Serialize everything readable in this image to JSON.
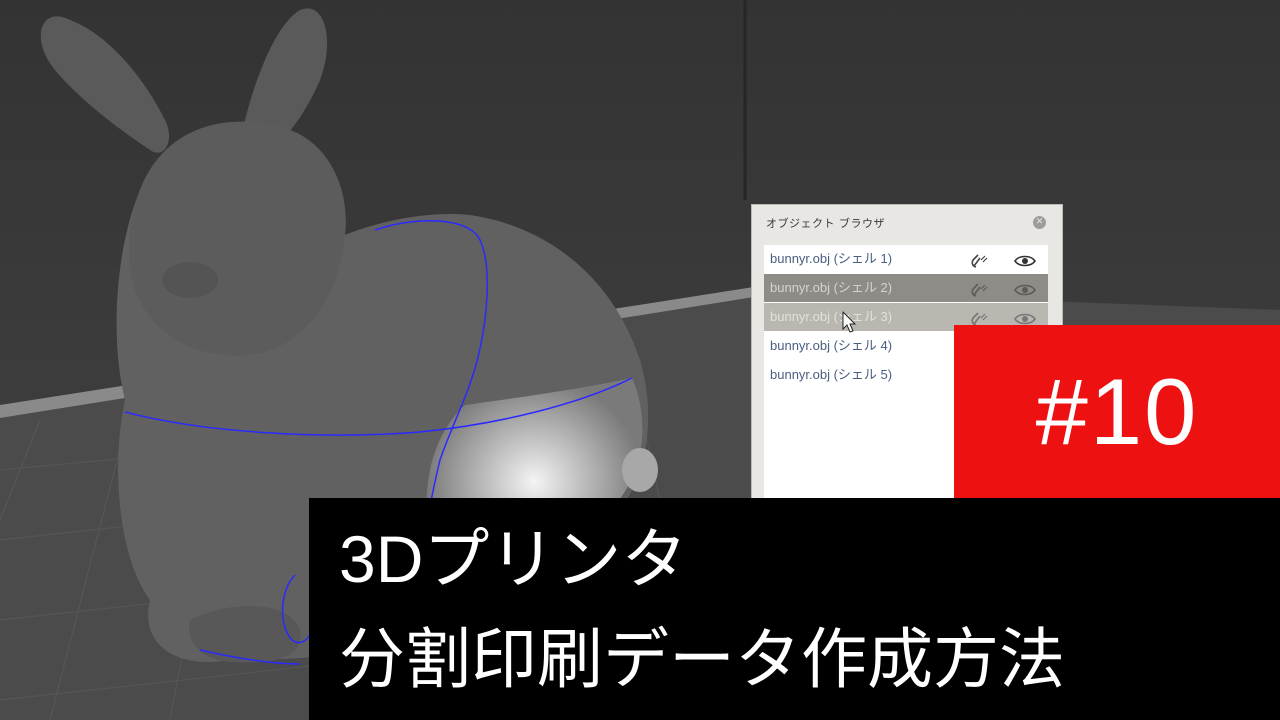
{
  "panel": {
    "title": "オブジェクト ブラウザ",
    "items": [
      {
        "label": "bunnyr.obj (シェル 1)",
        "state": "normal",
        "icons": [
          "magnet-icon",
          "eye-icon"
        ]
      },
      {
        "label": "bunnyr.obj (シェル 2)",
        "state": "selected",
        "icons": [
          "magnet-icon",
          "eye-icon"
        ]
      },
      {
        "label": "bunnyr.obj (シェル 3)",
        "state": "selected",
        "icons": [
          "magnet-icon",
          "eye-icon"
        ]
      },
      {
        "label": "bunnyr.obj (シェル 4)",
        "state": "normal",
        "icons": []
      },
      {
        "label": "bunnyr.obj (シェル 5)",
        "state": "normal",
        "icons": []
      }
    ]
  },
  "badge": {
    "text": "#10",
    "color": "#ee1111"
  },
  "caption": {
    "line1": "3Dプリンタ",
    "line2": "分割印刷データ作成方法"
  },
  "colors": {
    "seam": "#2a2aff",
    "background": "#3a3a3a",
    "floor": "#4b4b4b"
  }
}
